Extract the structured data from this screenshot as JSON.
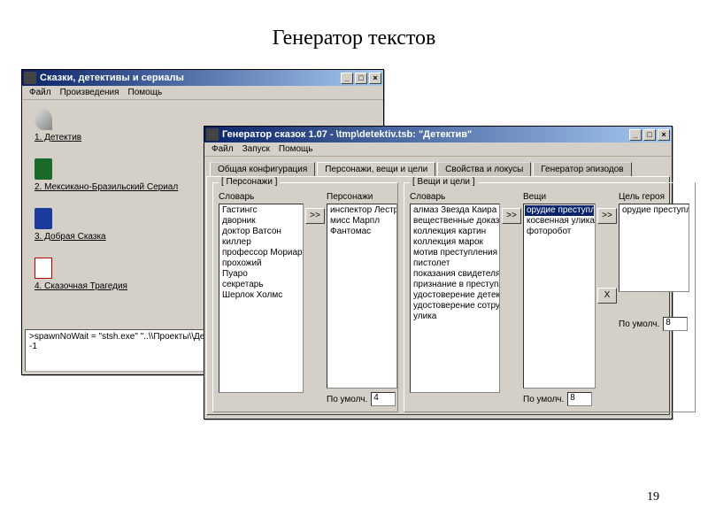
{
  "page": {
    "title": "Генератор текстов",
    "page_number": "19"
  },
  "win1": {
    "title": "Сказки, детективы и сериалы",
    "menu": [
      "Файл",
      "Произведения",
      "Помощь"
    ],
    "icons": [
      {
        "label": "1. Детектив"
      },
      {
        "label": "2. Мексикано-Бразильский Сериал"
      },
      {
        "label": "3. Добрая Сказка"
      },
      {
        "label": "4. Сказочная Трагедия"
      }
    ],
    "status_l1": ">spawnNoWait = \"stsh.exe\" \"..\\\\Проекты\\\\Детектив.sp",
    "status_l2": "-1"
  },
  "win_buttons": {
    "min": "_",
    "max": "□",
    "close": "×"
  },
  "win2": {
    "title": "Генератор сказок 1.07 - \\tmp\\detektiv.tsb:   \"Детектив\"",
    "menu": [
      "Файл",
      "Запуск",
      "Помощь"
    ],
    "tabs": [
      "Общая конфигурация",
      "Персонажи, вещи и цели",
      "Свойства и локусы",
      "Генератор эпизодов"
    ],
    "group1": {
      "legend": "[ Персонажи ]",
      "label_dict": "Словарь",
      "label_list": "Персонажи",
      "dict": [
        "Гастингс",
        "дворник",
        "доктор Ватсон",
        "киллер",
        "профессор Мориарти",
        "прохожий",
        "Пуаро",
        "секретарь",
        "Шерлок Холмс"
      ],
      "list": [
        "инспектор Лестрейд",
        "мисс Марпл",
        "Фантомас"
      ],
      "default_label": "По умолч.",
      "default_value": "4"
    },
    "group2": {
      "legend": "[ Вещи и цели ]",
      "label_dict": "Словарь",
      "label_list": "Вещи",
      "label_goal": "Цель героя",
      "dict": [
        "алмаз Звезда Каира",
        "вещественные доказа",
        "коллекция картин",
        "коллекция марок",
        "мотив преступления",
        "пистолет",
        "показания свидетеля",
        "признание в преступле",
        "удостоверение детект",
        "удостоверение сотруд",
        "улика"
      ],
      "list": [
        "орудие преступления",
        "косвенная улика",
        "фоторобот"
      ],
      "goal": [
        "орудие преступления"
      ],
      "default_label": "По умолч.",
      "default_value": "8",
      "goal_default_label": "По умолч.",
      "goal_default_value": "8"
    },
    "btn_right": ">>",
    "btn_x": "X"
  }
}
